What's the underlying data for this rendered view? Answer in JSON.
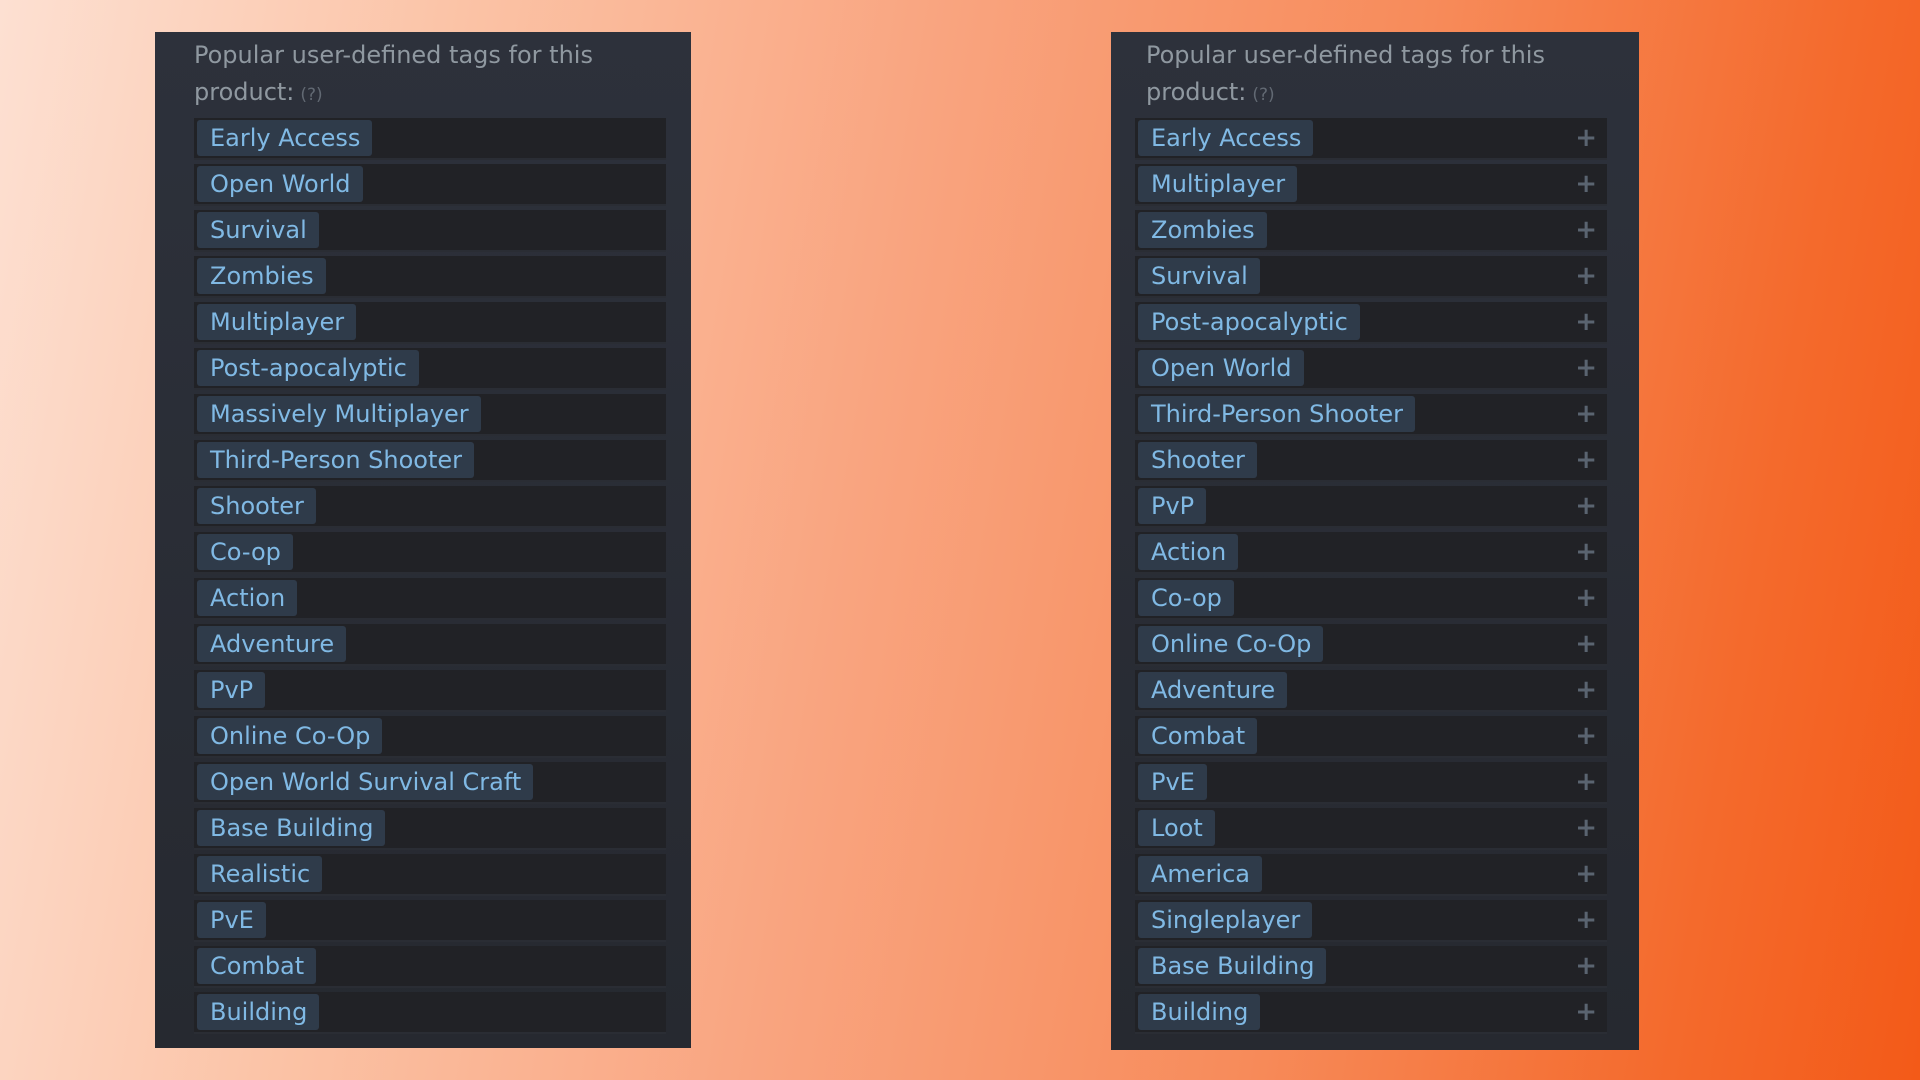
{
  "panels": [
    {
      "heading": "Popular user-defined tags for this product:",
      "help": "(?)",
      "tags": [
        "Early Access",
        "Open World",
        "Survival",
        "Zombies",
        "Multiplayer",
        "Post-apocalyptic",
        "Massively Multiplayer",
        "Third-Person Shooter",
        "Shooter",
        "Co-op",
        "Action",
        "Adventure",
        "PvP",
        "Online Co-Op",
        "Open World Survival Craft",
        "Base Building",
        "Realistic",
        "PvE",
        "Combat",
        "Building"
      ],
      "show_add_icon": false
    },
    {
      "heading": "Popular user-defined tags for this product:",
      "help": "(?)",
      "tags": [
        "Early Access",
        "Multiplayer",
        "Zombies",
        "Survival",
        "Post-apocalyptic",
        "Open World",
        "Third-Person Shooter",
        "Shooter",
        "PvP",
        "Action",
        "Co-op",
        "Online Co-Op",
        "Adventure",
        "Combat",
        "PvE",
        "Loot",
        "America",
        "Singleplayer",
        "Base Building",
        "Building"
      ],
      "show_add_icon": true,
      "add_icon_glyph": "+"
    }
  ],
  "colors": {
    "tag_text": "#80b9e4",
    "tag_bg": "#2f3b4a",
    "panel_bg": "#2d313b",
    "heading_text": "#8f98a0"
  }
}
